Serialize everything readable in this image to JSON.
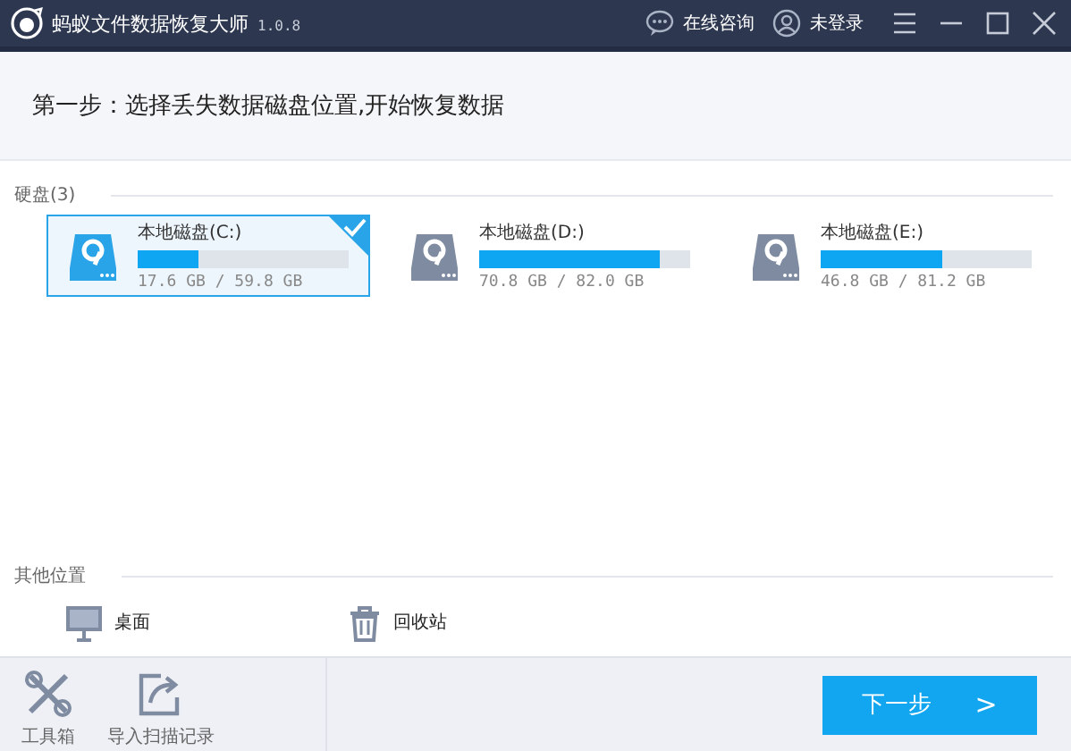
{
  "window": {
    "title": "蚂蚁文件数据恢复大师",
    "version": "1.0.8",
    "actions": [
      {
        "kind": "chat",
        "label": "在线咨询"
      },
      {
        "kind": "user",
        "label": "未登录"
      }
    ]
  },
  "step": {
    "title": "第一步：选择丢失数据磁盘位置,开始恢复数据"
  },
  "disks": {
    "label": "硬盘(3)",
    "items": [
      {
        "name": "本地磁盘(C:)",
        "usage": "17.6 GB / 59.8 GB",
        "level": 0.29,
        "selected": true
      },
      {
        "name": "本地磁盘(D:)",
        "usage": "70.8 GB / 82.0 GB",
        "level": 0.86,
        "selected": false
      },
      {
        "name": "本地磁盘(E:)",
        "usage": "46.8 GB / 81.2 GB",
        "level": 0.58,
        "selected": false
      }
    ]
  },
  "other_locations": {
    "label": "其他位置",
    "items": [
      {
        "kind": "desktop",
        "label": "桌面"
      },
      {
        "kind": "trash",
        "label": "回收站"
      }
    ]
  },
  "footer": {
    "tools": [
      {
        "kind": "toolbox",
        "label": "工具箱"
      },
      {
        "kind": "import",
        "label": "导入扫描记录"
      }
    ],
    "next_button": {
      "label": "下一步",
      "icon": ">"
    }
  }
}
